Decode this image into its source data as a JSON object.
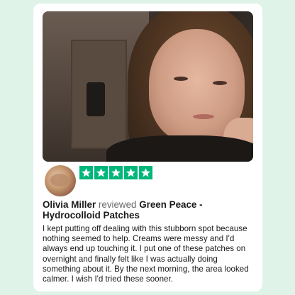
{
  "review": {
    "rating": 5,
    "max_rating": 5,
    "reviewer_name": "Olivia Miller",
    "reviewed_label": "reviewed",
    "product_name": "Green Peace - Hydrocolloid Patches",
    "text": "I kept putting off dealing with this stubborn spot because nothing seemed to help. Creams were messy and I'd always end up touching it. I put one of these patches on overnight and finally felt like I was actually doing something about it. By the next morning, the area looked calmer. I wish I'd tried these sooner."
  },
  "colors": {
    "background": "#dff3e8",
    "card": "#ffffff",
    "star_fill": "#00b67a",
    "text": "#1a1a1a",
    "muted_text": "#6a6a6a"
  }
}
